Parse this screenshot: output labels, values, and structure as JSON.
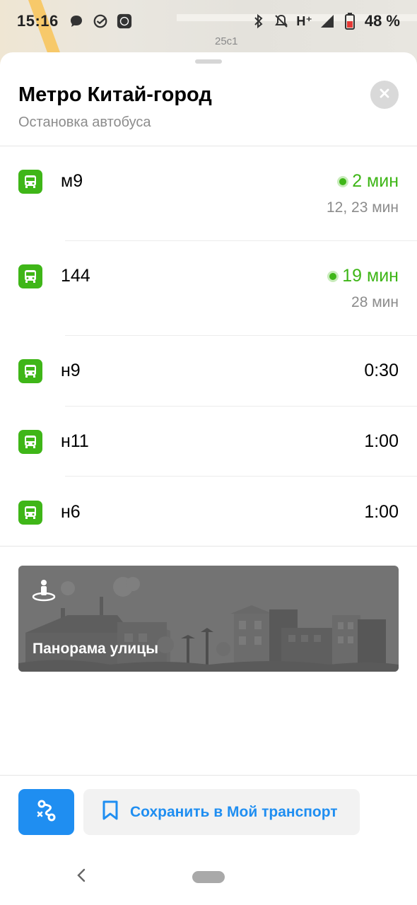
{
  "status_bar": {
    "time": "15:16",
    "network": "H⁺",
    "battery_percent": "48 %"
  },
  "map": {
    "label": "25с1"
  },
  "stop": {
    "title": "Метро Китай-город",
    "subtitle": "Остановка автобуса"
  },
  "routes": [
    {
      "number": "м9",
      "time": "2 мин",
      "next": "12, 23 мин",
      "live": true
    },
    {
      "number": "144",
      "time": "19 мин",
      "next": "28 мин",
      "live": true
    },
    {
      "number": "н9",
      "time": "0:30",
      "next": "",
      "live": false
    },
    {
      "number": "н11",
      "time": "1:00",
      "next": "",
      "live": false
    },
    {
      "number": "н6",
      "time": "1:00",
      "next": "",
      "live": false
    }
  ],
  "panorama": {
    "label": "Панорама улицы"
  },
  "footer": {
    "save_label": "Сохранить в Мой транспорт"
  },
  "colors": {
    "accent_green": "#3fb618",
    "accent_blue": "#1f8ef1"
  },
  "icons": [
    "chat-icon",
    "sber-icon",
    "app-icon",
    "bluetooth-icon",
    "bell-off-icon",
    "signal-icon",
    "battery-icon",
    "close-icon",
    "bus-icon",
    "panorama-icon",
    "route-icon",
    "bookmark-icon",
    "back-icon"
  ]
}
